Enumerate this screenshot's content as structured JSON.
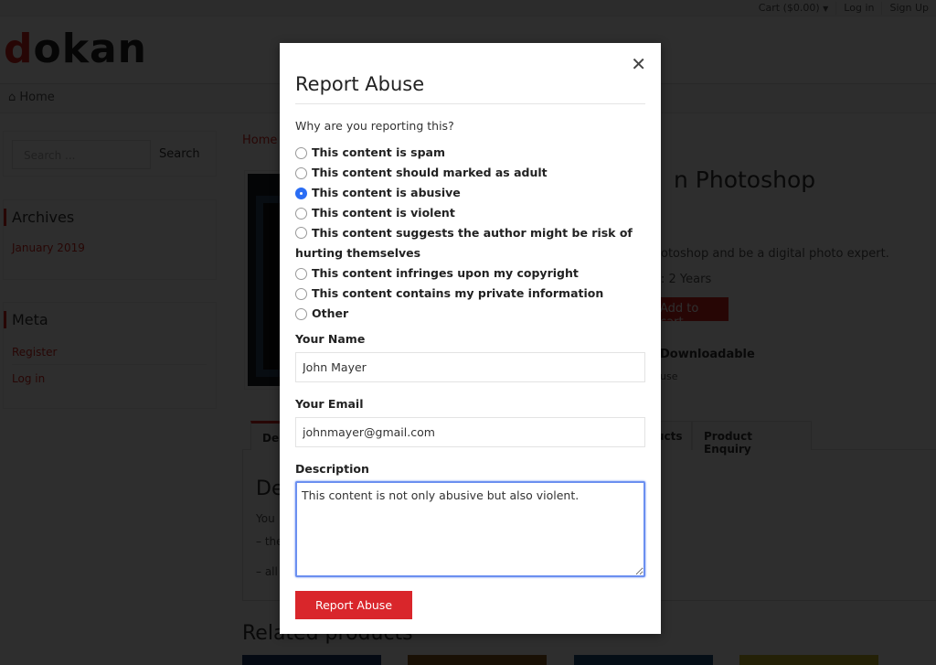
{
  "site": {
    "logo_first": "d",
    "logo_rest": "okan",
    "topbar": {
      "cart_label": "Cart",
      "cart_amount": "($0.00)",
      "login": "Log in",
      "signup": "Sign Up"
    },
    "nav": {
      "home_icon": "home-icon",
      "home": "Home"
    }
  },
  "sidebar": {
    "search": {
      "placeholder": "Search ...",
      "button": "Search"
    },
    "archives": {
      "title": "Archives",
      "items": [
        "January 2019"
      ]
    },
    "meta": {
      "title": "Meta",
      "items": [
        "Register",
        "Log in"
      ]
    }
  },
  "product": {
    "breadcrumb": "Home",
    "title_visible": "n Photoshop",
    "description_visible": "otoshop and be a digital photo expert.",
    "duration_visible": ": 2 Years",
    "add_to_cart": "Add to cart",
    "type_visible": "Downloadable",
    "use_visible": "use",
    "tabs": {
      "description": "De",
      "more": "ucts",
      "enquiry": "Product Enquiry"
    },
    "panel": {
      "heading": "De",
      "line1": "You",
      "line2": "– the",
      "line3": "– all"
    },
    "related_heading": "Related products",
    "related_thumb_colors": [
      "#1e3a6b",
      "#8a5a1c",
      "#1f4f7a",
      "#c9b42a"
    ]
  },
  "modal": {
    "title": "Report Abuse",
    "close_icon": "close-icon",
    "question": "Why are you reporting this?",
    "options": [
      {
        "label": "This content is spam",
        "checked": false
      },
      {
        "label": "This content should marked as adult",
        "checked": false
      },
      {
        "label": "This content is abusive",
        "checked": true
      },
      {
        "label": "This content is violent",
        "checked": false
      },
      {
        "label": "This content suggests the author might be risk of hurting themselves",
        "checked": false
      },
      {
        "label": "This content infringes upon my copyright",
        "checked": false
      },
      {
        "label": "This content contains my private information",
        "checked": false
      },
      {
        "label": "Other",
        "checked": false
      }
    ],
    "name_label": "Your Name",
    "name_value": "John Mayer",
    "email_label": "Your Email",
    "email_value": "johnmayer@gmail.com",
    "description_label": "Description",
    "description_value": "This content is not only abusive but also violent.",
    "submit": "Report Abuse"
  }
}
